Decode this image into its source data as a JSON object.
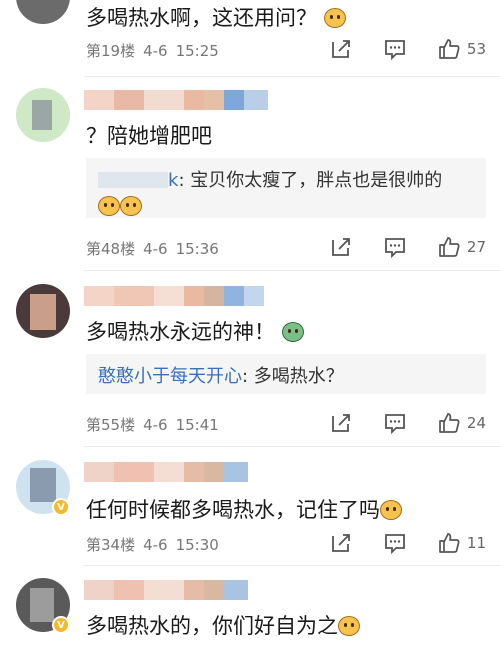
{
  "comments": [
    {
      "text": "多喝热水啊，这还用问？",
      "floor": "第19楼",
      "date": "4-6",
      "time": "15:25",
      "likes": "53"
    },
    {
      "text": "？陪她增肥吧",
      "quote": {
        "user_tail": "k",
        "text": "宝贝你太瘦了，胖点也是很帅的"
      },
      "floor": "第48楼",
      "date": "4-6",
      "time": "15:36",
      "likes": "27"
    },
    {
      "text": "多喝热水永远的神！",
      "quote": {
        "user": "憨憨小于每天开心",
        "text": "多喝热水？"
      },
      "floor": "第55楼",
      "date": "4-6",
      "time": "15:41",
      "likes": "24"
    },
    {
      "text": "任何时候都多喝热水，记住了吗",
      "floor": "第34楼",
      "date": "4-6",
      "time": "15:30",
      "likes": "11"
    },
    {
      "text": "多喝热水的，你们好自为之"
    }
  ],
  "icons": [
    "share-icon",
    "comment-icon",
    "thumbs-up-icon",
    "emoji-icon",
    "verified-badge-icon"
  ],
  "colors": {
    "link": "#3b6fb6",
    "meta": "#777777",
    "quote_bg": "#f5f5f5"
  }
}
